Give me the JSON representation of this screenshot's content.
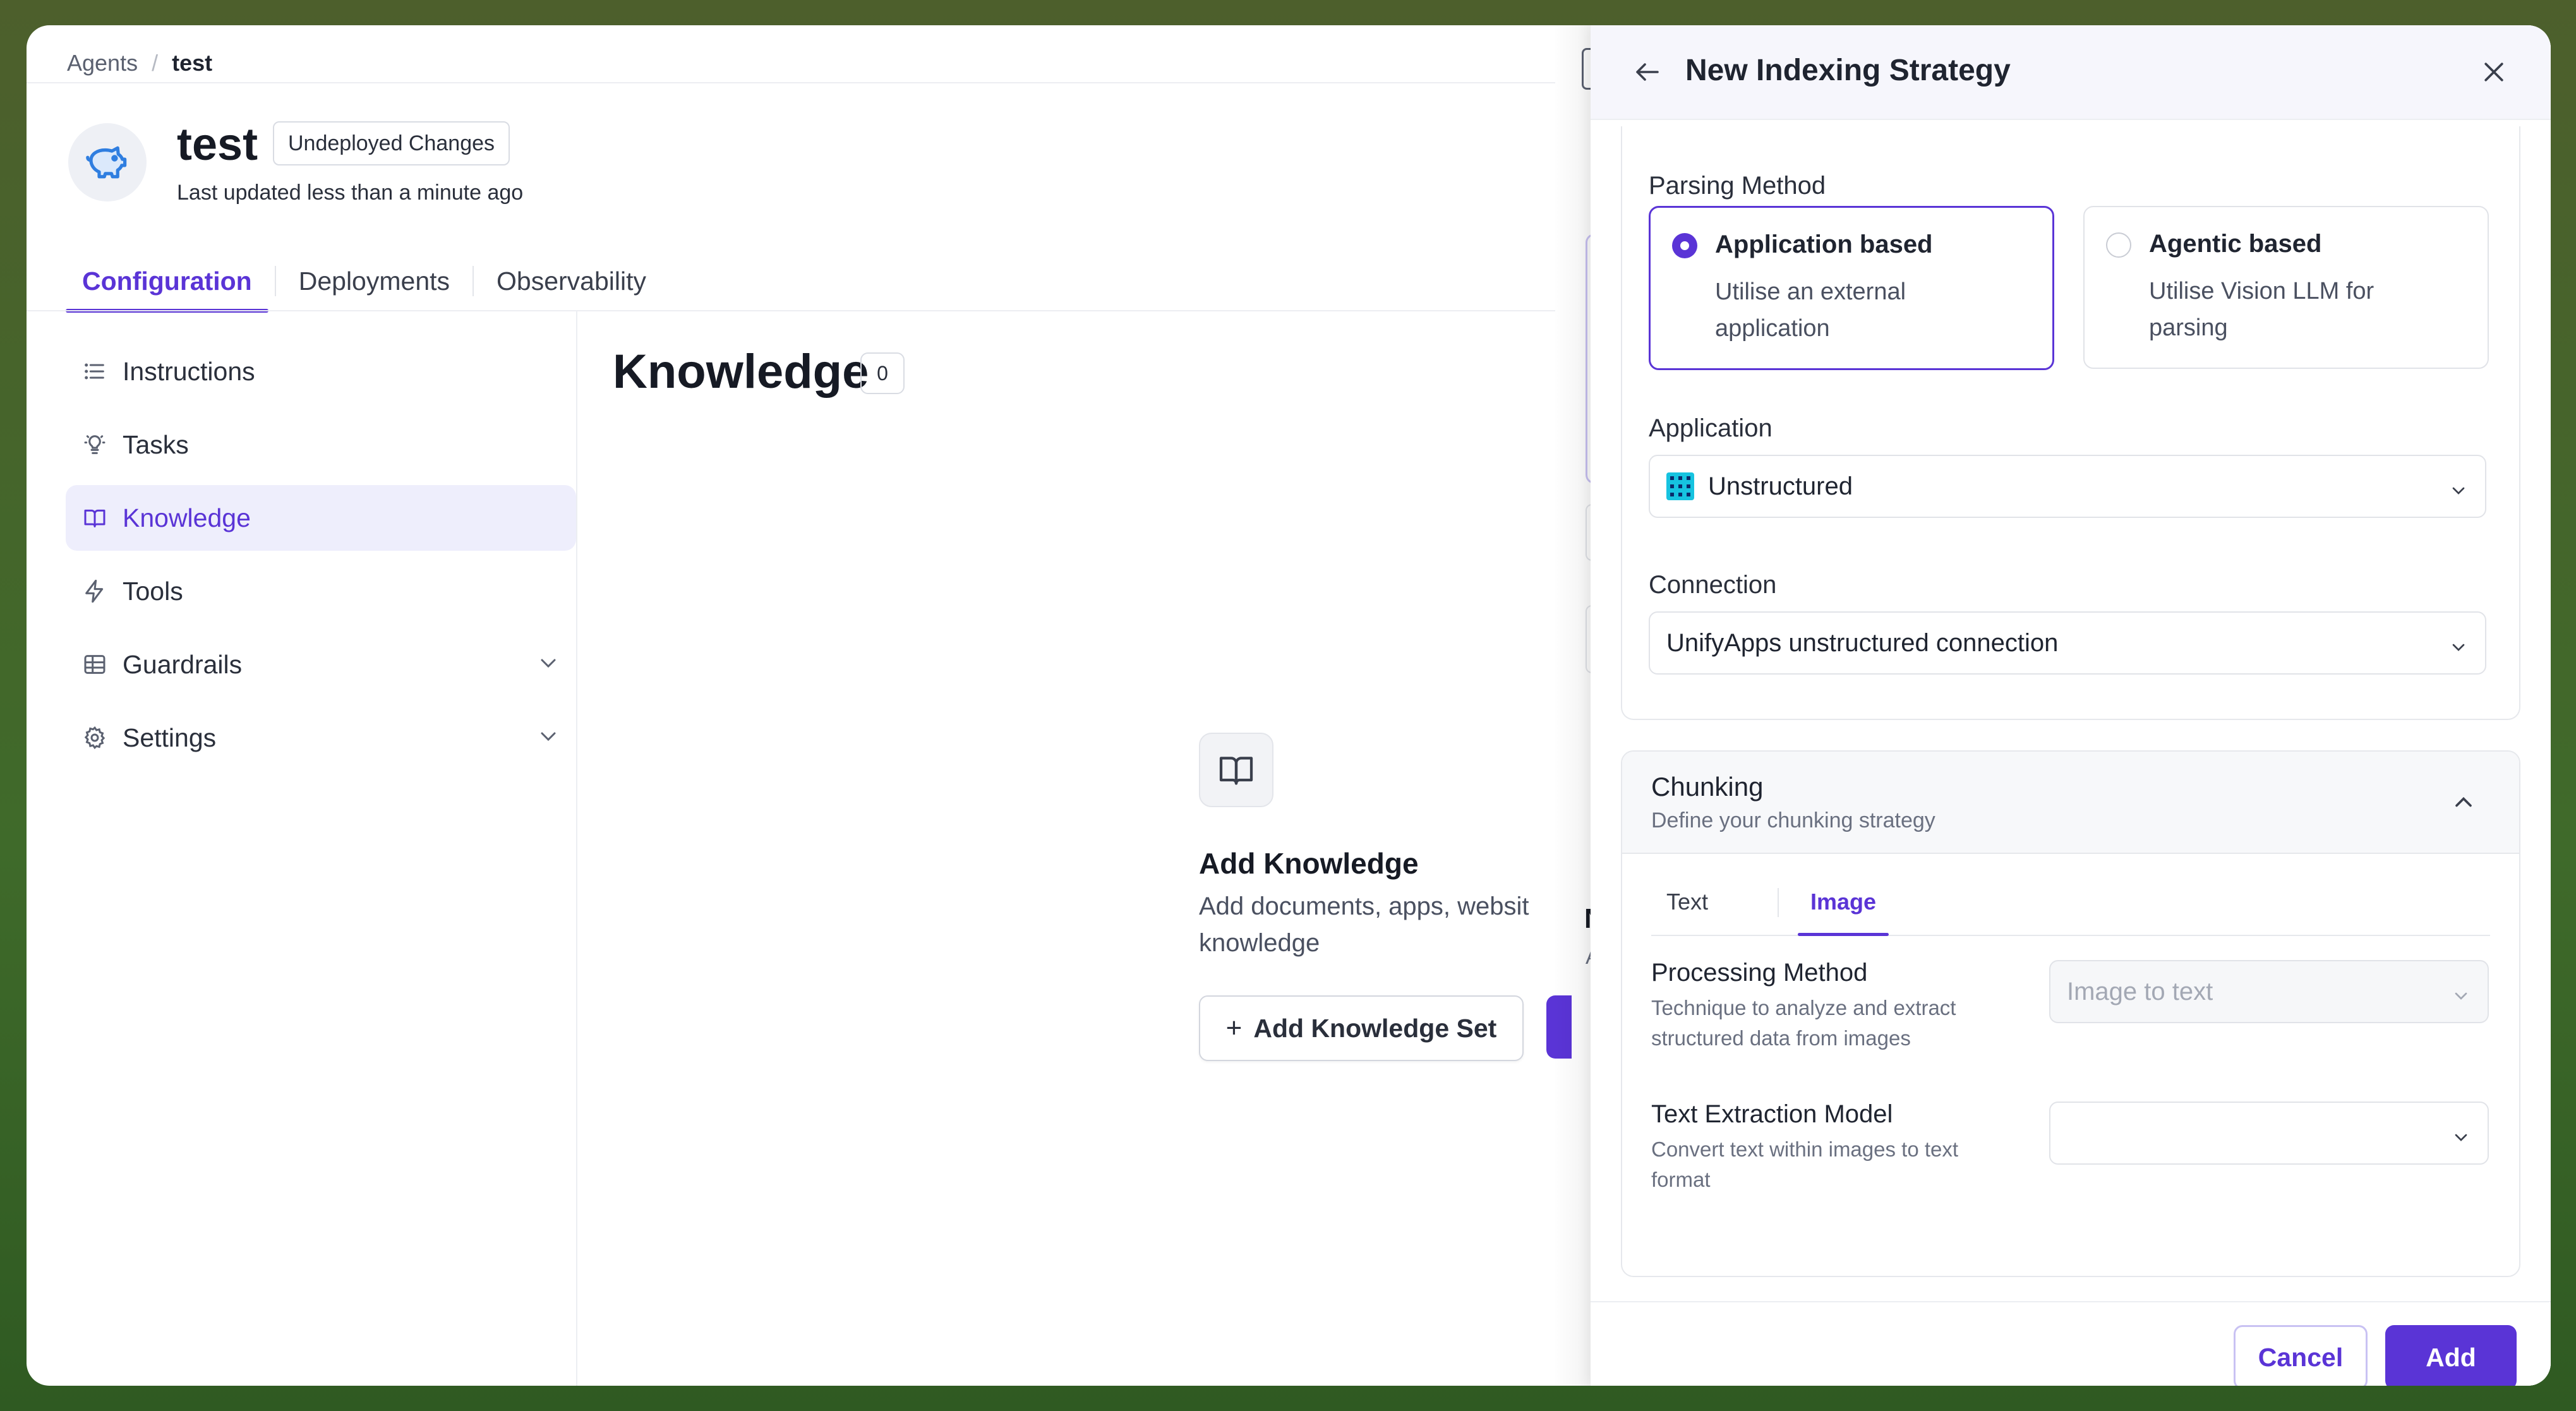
{
  "breadcrumb": {
    "root": "Agents",
    "separator": "/",
    "current": "test"
  },
  "agent": {
    "name": "test",
    "status_badge": "Undeployed Changes",
    "updated": "Last updated less than a minute ago"
  },
  "tabs": [
    {
      "label": "Configuration",
      "active": true
    },
    {
      "label": "Deployments",
      "active": false
    },
    {
      "label": "Observability",
      "active": false
    }
  ],
  "sidebar": {
    "items": [
      {
        "label": "Instructions",
        "icon": "list-icon"
      },
      {
        "label": "Tasks",
        "icon": "lightbulb-icon"
      },
      {
        "label": "Knowledge",
        "icon": "book-icon",
        "active": true
      },
      {
        "label": "Tools",
        "icon": "lightning-icon"
      },
      {
        "label": "Guardrails",
        "icon": "table-icon",
        "expandable": true
      },
      {
        "label": "Settings",
        "icon": "gear-icon",
        "expandable": true
      }
    ]
  },
  "knowledge": {
    "title": "Knowledge",
    "count": "0",
    "empty_title": "Add Knowledge",
    "empty_desc_line1": "Add documents, apps, websit",
    "empty_desc_line2": "knowledge",
    "add_set_label": "Add Knowledge Set",
    "peek_letter": "N",
    "peek_letter2": "A"
  },
  "drawer": {
    "title": "New Indexing Strategy",
    "parsing_method": {
      "label": "Parsing Method",
      "options": [
        {
          "title": "Application based",
          "desc": "Utilise an external application",
          "selected": true
        },
        {
          "title": "Agentic based",
          "desc": "Utilise Vision LLM for parsing",
          "selected": false
        }
      ]
    },
    "application": {
      "label": "Application",
      "value": "Unstructured"
    },
    "connection": {
      "label": "Connection",
      "value": "UnifyApps unstructured connection"
    },
    "chunking": {
      "title": "Chunking",
      "subtitle": "Define your chunking strategy",
      "tabs": [
        {
          "label": "Text",
          "active": false
        },
        {
          "label": "Image",
          "active": true
        }
      ],
      "processing_method": {
        "label": "Processing Method",
        "desc": "Technique to analyze and extract structured data from images",
        "value": "Image to text",
        "disabled": true
      },
      "text_extraction_model": {
        "label": "Text Extraction Model",
        "desc": "Convert text within images to text format",
        "value": ""
      }
    },
    "footer": {
      "cancel": "Cancel",
      "add": "Add"
    }
  },
  "colors": {
    "accent": "#5a34d6",
    "background": "#3f6a2a",
    "app_logo": "#16c3e0"
  }
}
